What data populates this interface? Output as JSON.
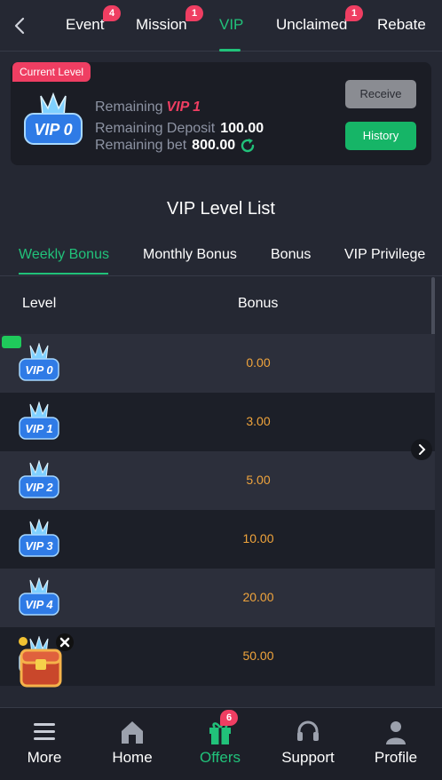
{
  "top_nav": {
    "tabs": [
      {
        "label": "Event",
        "badge": "4"
      },
      {
        "label": "Mission",
        "badge": "1"
      },
      {
        "label": "VIP",
        "badge": ""
      },
      {
        "label": "Unclaimed",
        "badge": "1"
      },
      {
        "label": "Rebate",
        "badge": ""
      }
    ],
    "active_tab": "VIP"
  },
  "current_level": {
    "tag": "Current Level",
    "badge_text": "VIP 0",
    "remaining_label": "Remaining",
    "remaining_vip": "VIP 1",
    "deposit_label": "Remaining Deposit",
    "deposit_value": "100.00",
    "bet_label": "Remaining bet",
    "bet_value": "800.00",
    "receive_label": "Receive",
    "history_label": "History"
  },
  "list_title": "VIP Level List",
  "sub_tabs": [
    "Weekly Bonus",
    "Monthly Bonus",
    "Bonus",
    "VIP Privilege"
  ],
  "active_sub_tab": "Weekly Bonus",
  "table": {
    "headers": [
      "Level",
      "Bonus"
    ],
    "rows": [
      {
        "level": "VIP 0",
        "bonus": "0.00",
        "current": true
      },
      {
        "level": "VIP 1",
        "bonus": "3.00"
      },
      {
        "level": "VIP 2",
        "bonus": "5.00"
      },
      {
        "level": "VIP 3",
        "bonus": "10.00"
      },
      {
        "level": "VIP 4",
        "bonus": "20.00"
      },
      {
        "level": "VIP 5",
        "bonus": "50.00"
      }
    ]
  },
  "bottom_nav": {
    "items": [
      {
        "label": "More",
        "icon": "menu-icon"
      },
      {
        "label": "Home",
        "icon": "home-icon"
      },
      {
        "label": "Offers",
        "icon": "gift-icon",
        "badge": "6"
      },
      {
        "label": "Support",
        "icon": "headset-icon"
      },
      {
        "label": "Profile",
        "icon": "user-icon"
      }
    ],
    "active": "Offers"
  },
  "colors": {
    "accent": "#21c27a",
    "badge": "#ef3e62",
    "bonus_value": "#f0a43c",
    "background": "#252833"
  }
}
